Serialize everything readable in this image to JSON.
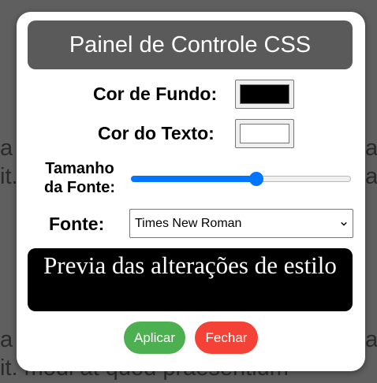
{
  "background": {
    "lines": [
      " a",
      "it.",
      " a",
      "it. modi at quod praesentium"
    ],
    "right_fragments": [
      "a",
      "a",
      "a"
    ]
  },
  "panel": {
    "title": "Painel de Controle CSS",
    "bg_color_label": "Cor de Fundo:",
    "bg_color_value": "#000000",
    "text_color_label": "Cor do Texto:",
    "text_color_value": "#ffffff",
    "font_size_label": "Tamanho da Fonte:",
    "font_size_percent": 57,
    "font_label": "Fonte:",
    "font_selected": "Times New Roman",
    "preview_text": "Previa das alterações de estilo",
    "apply_label": "Aplicar",
    "close_label": "Fechar"
  }
}
